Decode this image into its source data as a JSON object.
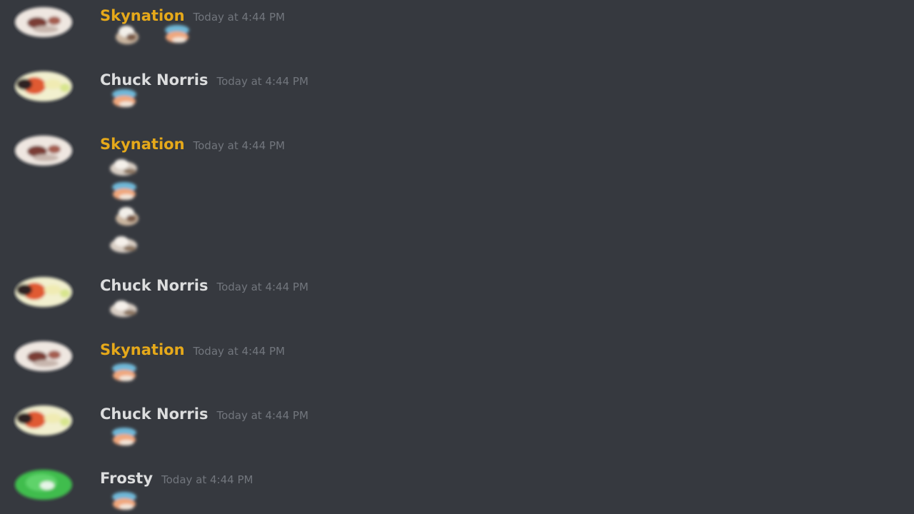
{
  "colors": {
    "background": "#36393f",
    "username_default": "#dcddde",
    "username_gold": "#e6a91a",
    "timestamp": "#72767d"
  },
  "messages": [
    {
      "username": "Skynation",
      "timestamp": "Today at 4:44 PM",
      "avatar": "skull-avatar",
      "emojis": [
        "stack-emoji",
        "stack-emoji"
      ]
    },
    {
      "username": "Chuck Norris",
      "timestamp": "Today at 4:44 PM",
      "avatar": "fish-avatar",
      "emojis": [
        "stack-emoji"
      ]
    },
    {
      "username": "Skynation",
      "timestamp": "Today at 4:44 PM",
      "avatar": "skull-avatar",
      "emojis": [
        "stack-emoji",
        "stack-emoji",
        "stack-emoji",
        "stack-emoji"
      ]
    },
    {
      "username": "Chuck Norris",
      "timestamp": "Today at 4:44 PM",
      "avatar": "fish-avatar",
      "emojis": [
        "stack-emoji"
      ]
    },
    {
      "username": "Skynation",
      "timestamp": "Today at 4:44 PM",
      "avatar": "skull-avatar",
      "emojis": [
        "stack-emoji"
      ]
    },
    {
      "username": "Chuck Norris",
      "timestamp": "Today at 4:44 PM",
      "avatar": "fish-avatar",
      "emojis": [
        "stack-emoji"
      ]
    },
    {
      "username": "Frosty",
      "timestamp": "Today at 4:44 PM",
      "avatar": "green-avatar",
      "emojis": [
        "stack-emoji"
      ]
    }
  ]
}
